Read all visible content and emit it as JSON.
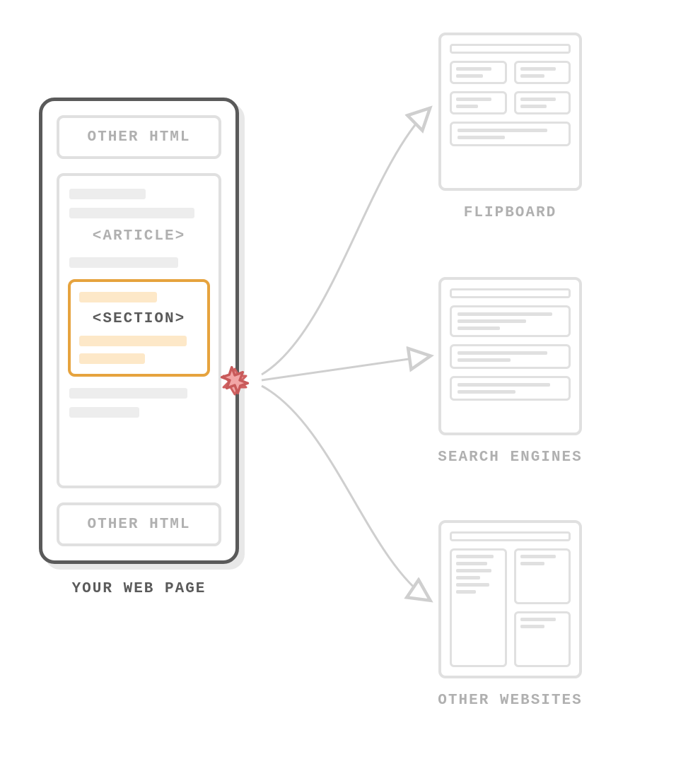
{
  "webpage": {
    "otherHtmlLabel": "OTHER HTML",
    "articleLabel": "<ARTICLE>",
    "sectionLabel": "<SECTION>",
    "caption": "YOUR WEB PAGE"
  },
  "targets": {
    "flipboard": "FLIPBOARD",
    "searchEngines": "SEARCH ENGINES",
    "otherWebsites": "OTHER WEBSITES"
  },
  "colors": {
    "stroke": "#5a5a5a",
    "light": "#e0e0e0",
    "highlight": "#e6a33e",
    "highlightFill": "#fde8c8",
    "error": "#e87a7a"
  }
}
